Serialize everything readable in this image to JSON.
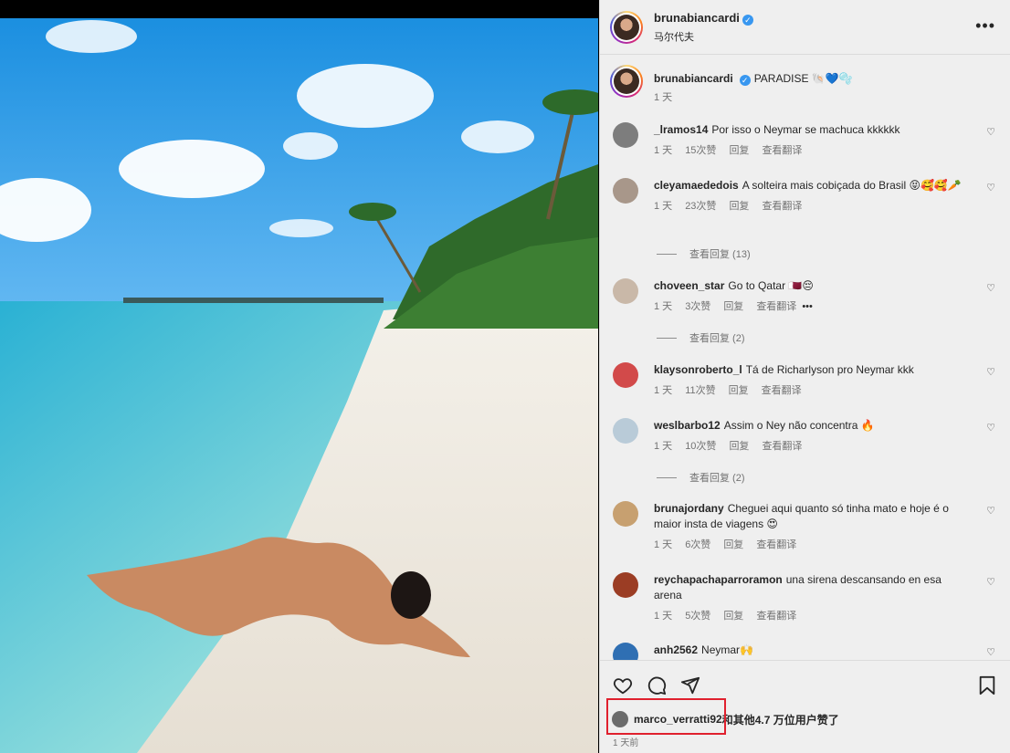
{
  "post": {
    "username": "brunabiancardi",
    "location": "马尔代夫",
    "more_label": "•••"
  },
  "caption": {
    "username": "brunabiancardi",
    "text": "PARADISE 🐚💙🫧",
    "time": "1 天"
  },
  "comments": [
    {
      "user": "_lramos14",
      "text": "Por isso o Neymar se machuca kkkkkk",
      "time": "1 天",
      "likes": "15次赞",
      "reply": "回复",
      "translate": "查看翻译"
    },
    {
      "user": "cleyamaededois",
      "text": "A solteira mais cobiçada do Brasil 😝🥰🥰🥕",
      "time": "1 天",
      "likes": "23次赞",
      "reply": "回复",
      "translate": "查看翻译",
      "view_replies": "查看回复 (13)"
    },
    {
      "user": "choveen_star",
      "text": "Go to Qatar 🇶🇦😔",
      "time": "1 天",
      "likes": "3次赞",
      "reply": "回复",
      "translate": "查看翻译",
      "extra": "•••",
      "view_replies": "查看回复 (2)"
    },
    {
      "user": "klaysonroberto_l",
      "text": "Tá de Richarlyson pro Neymar kkk",
      "time": "1 天",
      "likes": "11次赞",
      "reply": "回复",
      "translate": "查看翻译"
    },
    {
      "user": "weslbarbo12",
      "text": "Assim o Ney não concentra 🔥",
      "time": "1 天",
      "likes": "10次赞",
      "reply": "回复",
      "translate": "查看翻译",
      "view_replies": "查看回复 (2)"
    },
    {
      "user": "brunajordany",
      "text": "Cheguei aqui quanto só tinha mato e hoje é o maior insta de viagens 😍",
      "time": "1 天",
      "likes": "6次赞",
      "reply": "回复",
      "translate": "查看翻译"
    },
    {
      "user": "reychapachaparroramon",
      "text": "una sirena descansando en esa arena",
      "time": "1 天",
      "likes": "5次赞",
      "reply": "回复",
      "translate": "查看翻译"
    },
    {
      "user": "anh2562",
      "text": "Neymar🙌"
    }
  ],
  "footer": {
    "liked_by_user": "marco_verratti92",
    "liked_by_rest": "和其他4.7 万位用户赞了",
    "time": "1 天前"
  },
  "icons": {
    "like": "heart-icon",
    "comment": "comment-icon",
    "share": "share-icon",
    "save": "bookmark-icon"
  },
  "colors": {
    "verified": "#3897f0",
    "highlight_box": "#e0202e",
    "panel_bg": "#efefef"
  }
}
